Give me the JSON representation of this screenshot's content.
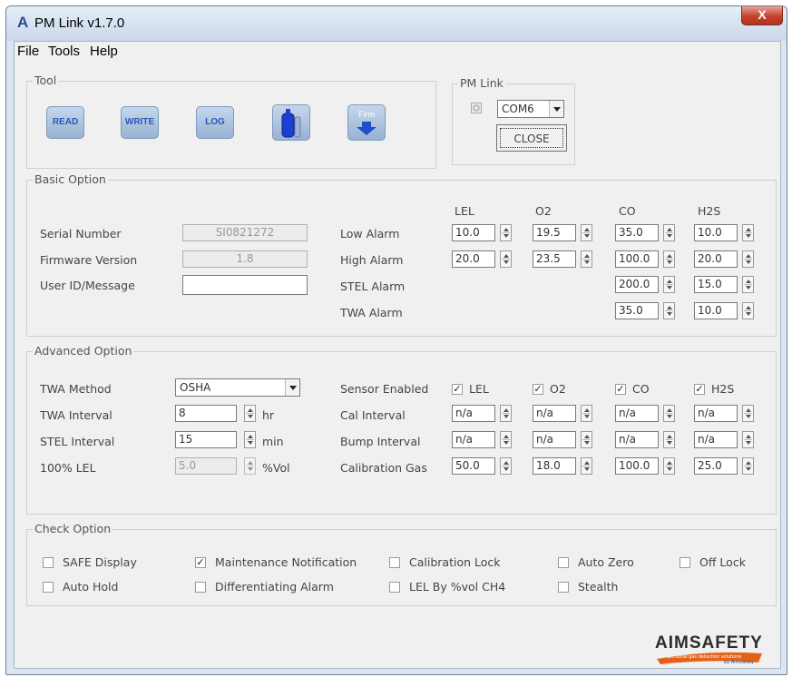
{
  "window": {
    "logo_letter": "A",
    "title": "PM Link v1.7.0",
    "close_glyph": "X"
  },
  "menu": {
    "file": "File",
    "tools": "Tools",
    "help": "Help"
  },
  "tool_group": {
    "title": "Tool",
    "buttons": [
      {
        "label": "READ"
      },
      {
        "label": "WRITE"
      },
      {
        "label": "LOG"
      },
      {
        "label": "",
        "icon": "gas-cylinder-icon"
      },
      {
        "label": "Firm",
        "icon": "firmware-arrow-icon"
      }
    ]
  },
  "pm_link": {
    "title": "PM Link",
    "port_icon": "port-status-icon",
    "port": "COM6",
    "close_label": "CLOSE"
  },
  "basic_option": {
    "title": "Basic Option",
    "serial_label": "Serial Number",
    "serial_value": "SI0821272",
    "firmware_label": "Firmware Version",
    "firmware_value": "1.8",
    "userid_label": "User ID/Message",
    "userid_value": "",
    "columns": [
      "LEL",
      "O2",
      "CO",
      "H2S"
    ],
    "low_alarm_label": "Low Alarm",
    "low_alarm": [
      "10.0",
      "19.5",
      "35.0",
      "10.0"
    ],
    "high_alarm_label": "High Alarm",
    "high_alarm": [
      "20.0",
      "23.5",
      "100.0",
      "20.0"
    ],
    "stel_alarm_label": "STEL Alarm",
    "stel_alarm": [
      "200.0",
      "15.0"
    ],
    "twa_alarm_label": "TWA Alarm",
    "twa_alarm": [
      "35.0",
      "10.0"
    ]
  },
  "advanced_option": {
    "title": "Advanced Option",
    "twa_method_label": "TWA Method",
    "twa_method": "OSHA",
    "twa_interval_label": "TWA Interval",
    "twa_interval": "8",
    "twa_interval_unit": "hr",
    "stel_interval_label": "STEL Interval",
    "stel_interval": "15",
    "stel_interval_unit": "min",
    "lel100_label": "100% LEL",
    "lel100": "5.0",
    "lel100_unit": "%Vol",
    "sensor_enabled_label": "Sensor Enabled",
    "sensors": [
      {
        "name": "LEL",
        "checked": true
      },
      {
        "name": "O2",
        "checked": true
      },
      {
        "name": "CO",
        "checked": true
      },
      {
        "name": "H2S",
        "checked": true
      }
    ],
    "cal_interval_label": "Cal Interval",
    "cal_interval": [
      "n/a",
      "n/a",
      "n/a",
      "n/a"
    ],
    "bump_interval_label": "Bump Interval",
    "bump_interval": [
      "n/a",
      "n/a",
      "n/a",
      "n/a"
    ],
    "calibration_gas_label": "Calibration Gas",
    "calibration_gas": [
      "50.0",
      "18.0",
      "100.0",
      "25.0"
    ]
  },
  "check_option": {
    "title": "Check Option",
    "items": [
      {
        "label": "SAFE Display",
        "checked": false
      },
      {
        "label": "Maintenance Notification",
        "checked": true
      },
      {
        "label": "Calibration Lock",
        "checked": false
      },
      {
        "label": "Auto Zero",
        "checked": false
      },
      {
        "label": "Off Lock",
        "checked": false
      },
      {
        "label": "Auto Hold",
        "checked": false
      },
      {
        "label": "Differentiating Alarm",
        "checked": false
      },
      {
        "label": "LEL By %vol CH4",
        "checked": false
      },
      {
        "label": "Stealth",
        "checked": false
      }
    ]
  },
  "brand": {
    "name": "AIMSAFETY",
    "tagline": "personal gas detection solutions",
    "sub": "by Aimsafety"
  },
  "colors": {
    "button_text": "#2a56b8",
    "title_close": "#c5412b",
    "brand_orange": "#e2621a"
  }
}
